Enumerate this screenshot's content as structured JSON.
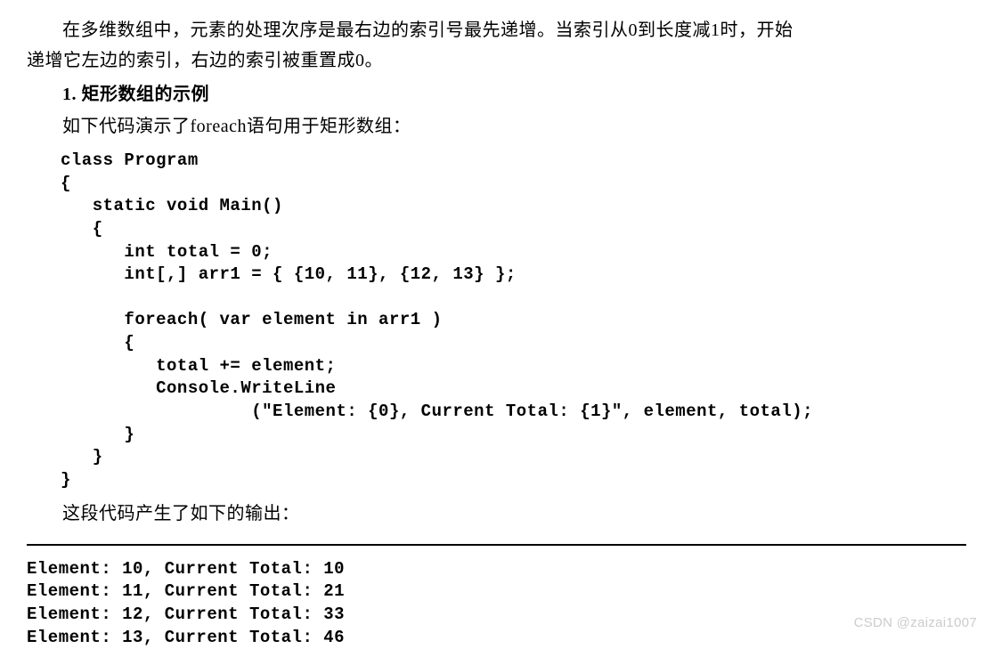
{
  "paragraph1_line1": "在多维数组中，元素的处理次序是最右边的索引号最先递增。当索引从0到长度减1时，开始",
  "paragraph1_line2": "递增它左边的索引，右边的索引被重置成0。",
  "heading": "1. 矩形数组的示例",
  "paragraph2": "如下代码演示了foreach语句用于矩形数组：",
  "code": "class Program\n{\n   static void Main()\n   {\n      int total = 0;\n      int[,] arr1 = { {10, 11}, {12, 13} };\n\n      foreach( var element in arr1 )\n      {\n         total += element;\n         Console.WriteLine\n                  (\"Element: {0}, Current Total: {1}\", element, total);\n      }\n   }\n}",
  "paragraph3": "这段代码产生了如下的输出：",
  "output": "Element: 10, Current Total: 10\nElement: 11, Current Total: 21\nElement: 12, Current Total: 33\nElement: 13, Current Total: 46",
  "watermark": "CSDN @zaizai1007"
}
